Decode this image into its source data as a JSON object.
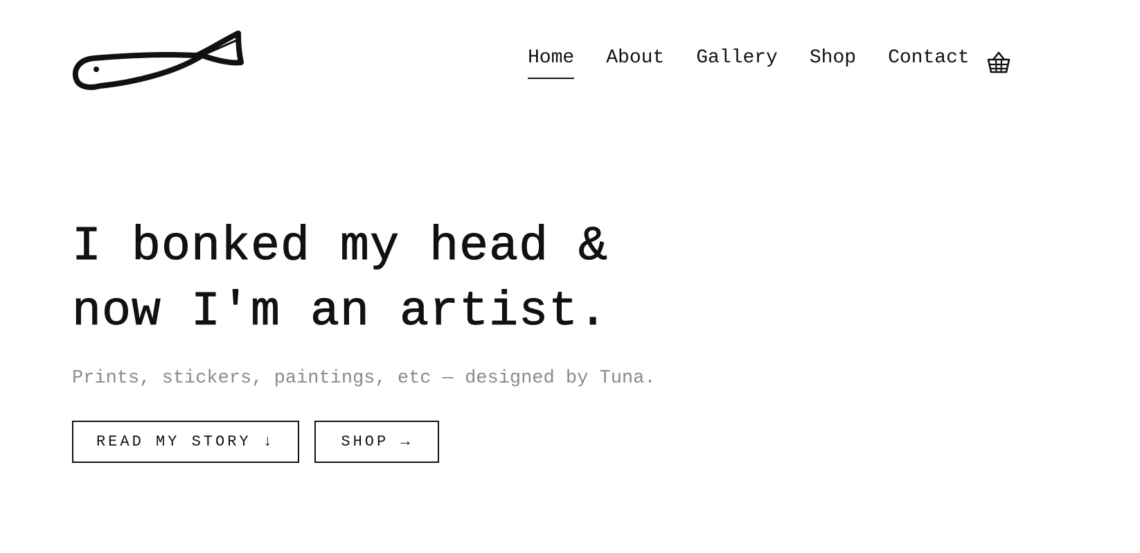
{
  "header": {
    "logo_name": "fish-logo-icon",
    "nav": [
      {
        "label": "Home",
        "active": true
      },
      {
        "label": "About",
        "active": false
      },
      {
        "label": "Gallery",
        "active": false
      },
      {
        "label": "Shop",
        "active": false
      },
      {
        "label": "Contact",
        "active": false
      }
    ],
    "cart_icon": "basket-icon"
  },
  "hero": {
    "title_line1": "I bonked my head &",
    "title_line2": "now I'm an artist.",
    "subtitle": "Prints, stickers, paintings, etc — designed by Tuna.",
    "buttons": {
      "story": "READ MY STORY ↓",
      "shop": "SHOP →"
    }
  },
  "colors": {
    "text": "#111111",
    "muted": "#8a8a8a",
    "background": "#ffffff"
  }
}
